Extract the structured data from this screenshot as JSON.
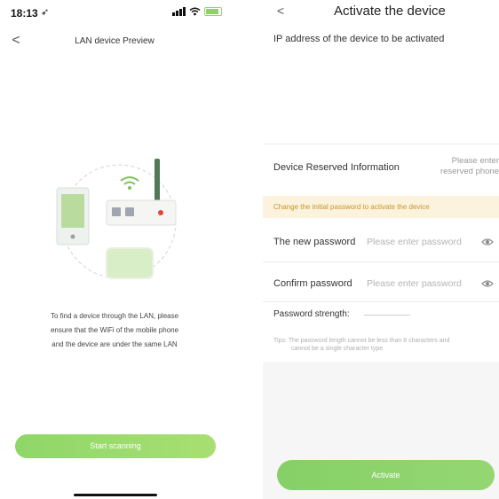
{
  "left": {
    "status": {
      "time": "18:13",
      "location_glyph": "➶"
    },
    "nav": {
      "back": "<",
      "title": "LAN device Preview"
    },
    "tip_lines": [
      "To find a device through the LAN, please",
      "ensure that the WiFi of the mobile phone",
      "and the device are under the same LAN"
    ],
    "scan_button": "Start scanning"
  },
  "right": {
    "nav": {
      "back": "<",
      "title": "Activate the device"
    },
    "ip_label": "IP address of the device to be activated",
    "reserved": {
      "label": "Device Reserved Information",
      "placeholder_lines": [
        "Please enter",
        "reserved phone"
      ]
    },
    "notice": "Change the initial password to activate the device",
    "new_password": {
      "label": "The new password",
      "placeholder": "Please enter password"
    },
    "confirm_password": {
      "label": "Confirm password",
      "placeholder": "Please enter password"
    },
    "strength_label": "Password strength:",
    "tips_lines": [
      "Tips: The password length cannot be less than 8 characters and",
      "cannot be a single character type"
    ],
    "activate_button": "Activate"
  },
  "colors": {
    "accent_green": "#8fd668",
    "notice_bg": "#fbf3dd",
    "notice_text": "#c9932a",
    "router_dot": "#e0443c",
    "antenna": "#4e7a58"
  }
}
